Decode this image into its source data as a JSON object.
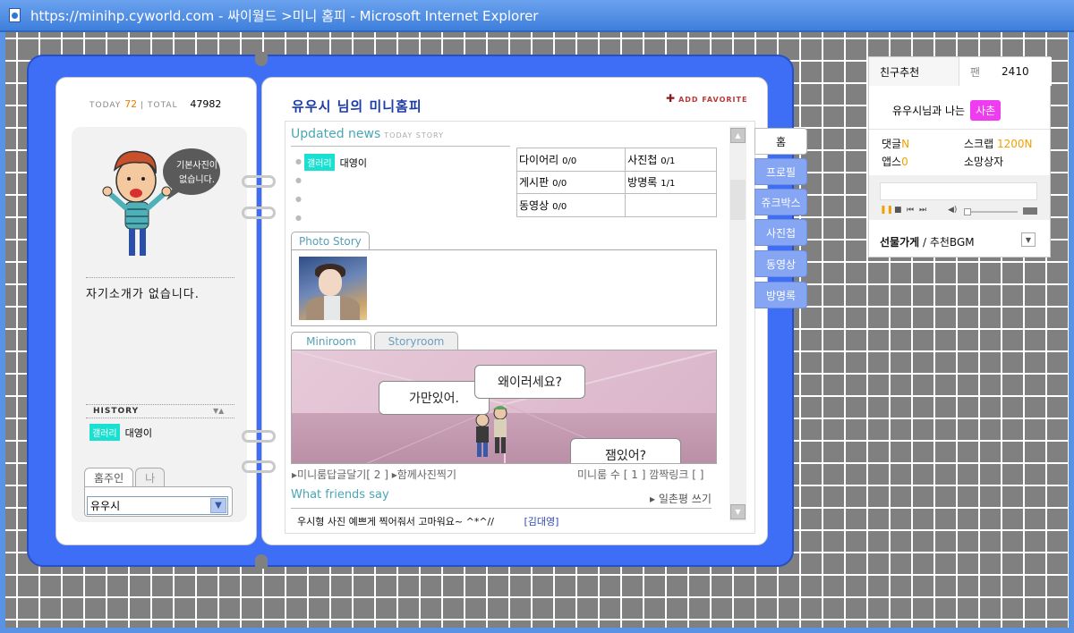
{
  "window": {
    "title": "https://minihp.cyworld.com - 싸이월드 >미니 홈피 - Microsoft Internet Explorer"
  },
  "counter": {
    "today_label": "TODAY",
    "today_value": "72",
    "sep": "|",
    "total_label": "TOTAL",
    "total_value": "47982"
  },
  "profile": {
    "default_photo_text": "기본사진이 없습니다.",
    "intro": "자기소개가 없습니다.",
    "history_label": "HISTORY",
    "history_tag": "갤러리",
    "history_text": "대영이",
    "owner_tabs": [
      "홈주인",
      "나"
    ],
    "owner_select": "유우시"
  },
  "home": {
    "title": "유우시 님의 미니홈피",
    "add_favorite": "ADD FAVORITE"
  },
  "updated_news": {
    "title": "Updated news",
    "subtitle": "TODAY STORY",
    "item_tag": "갤러리",
    "item_text": "대영이"
  },
  "stats": [
    {
      "label": "다이어리",
      "value": "0/0"
    },
    {
      "label": "사진첩",
      "value": "0/1"
    },
    {
      "label": "게시판",
      "value": "0/0"
    },
    {
      "label": "방명록",
      "value": "1/1"
    },
    {
      "label": "동영상",
      "value": "0/0"
    }
  ],
  "photo_story": {
    "tab": "Photo Story"
  },
  "miniroom": {
    "tabs": [
      "Miniroom",
      "Storyroom"
    ],
    "bubbles": [
      "가만있어.",
      "왜이러세요?",
      "잼있어?"
    ],
    "links_left": "▸미니룸답글달기[ 2 ] ▸함께사진찍기",
    "links_right": "미니룸 수 [ 1 ]   깜짝링크 [  ]"
  },
  "friends": {
    "title": "What friends say",
    "write": "▸ 일촌평 쓰기",
    "comment_text": "우시형 사진 예쁘게 찍어줘서 고마워요~ ^*^//",
    "comment_author": "[김대영]"
  },
  "menu": [
    "홈",
    "프로필",
    "쥬크박스",
    "사진첩",
    "동영상",
    "방명록"
  ],
  "widget": {
    "tab_friends": "친구추천",
    "tab_fan": "팬",
    "fan_count": "2410",
    "relation_text": "유우시님과 나는",
    "relation_badge": "사촌",
    "comments_label": "댓글",
    "comments_value": "N",
    "scrap_label": "스크랩",
    "scrap_value": "1200",
    "scrap_new": "N",
    "apps_label": "앱스",
    "apps_value": "0",
    "wish_label": "소망상자",
    "shop_label": "선물가게",
    "shop_sep": " / ",
    "bgm_label": "추천BGM"
  },
  "colors": {
    "diary_blue": "#3d6ef5",
    "menu_blue": "#86a6f4",
    "title_blue": "#1c3aa8",
    "accent_teal": "#4aa6b4",
    "badge_pink": "#f03cf0",
    "tag_cyan": "#19e0d0"
  }
}
